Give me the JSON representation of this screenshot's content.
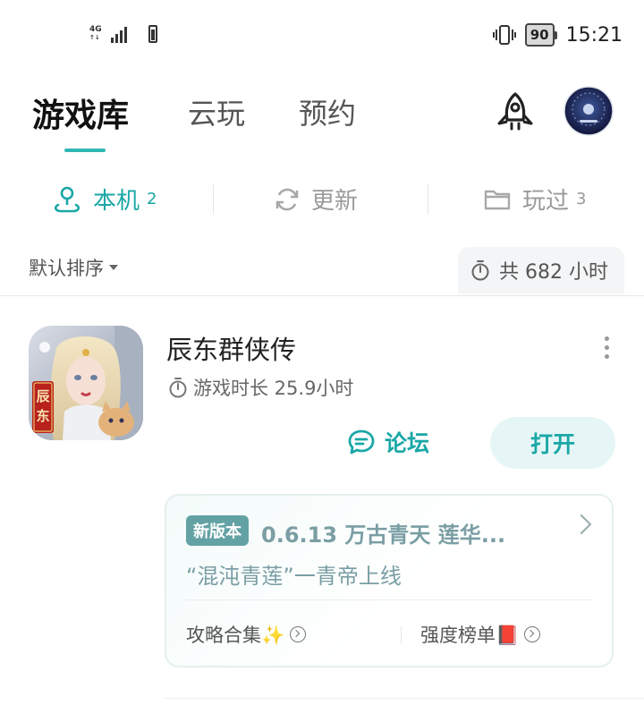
{
  "status": {
    "network": "4G",
    "battery": "90",
    "time": "15:21"
  },
  "top_tabs": [
    {
      "label": "游戏库",
      "active": true
    },
    {
      "label": "云玩",
      "active": false
    },
    {
      "label": "预约",
      "active": false
    }
  ],
  "sub_tabs": [
    {
      "label": "本机",
      "count": "2",
      "icon": "person-pin-icon",
      "active": true
    },
    {
      "label": "更新",
      "count": "",
      "icon": "refresh-icon",
      "active": false
    },
    {
      "label": "玩过",
      "count": "3",
      "icon": "folder-icon",
      "active": false
    }
  ],
  "sort": {
    "label": "默认排序"
  },
  "total": {
    "label": "共 682 小时"
  },
  "game": {
    "title": "辰东群侠传",
    "play_time": "游戏时长 25.9小时",
    "forum_label": "论坛",
    "open_label": "打开",
    "icon_text": "辰东"
  },
  "news": {
    "badge": "新版本",
    "headline": "0.6.13  万古青天  莲华...",
    "subtitle": "“混沌青莲”一青帝上线",
    "links": [
      {
        "label": "攻略合集✨"
      },
      {
        "label": "强度榜单📕"
      }
    ]
  },
  "colors": {
    "accent": "#1aa7a6",
    "badge": "#63a2a4"
  }
}
